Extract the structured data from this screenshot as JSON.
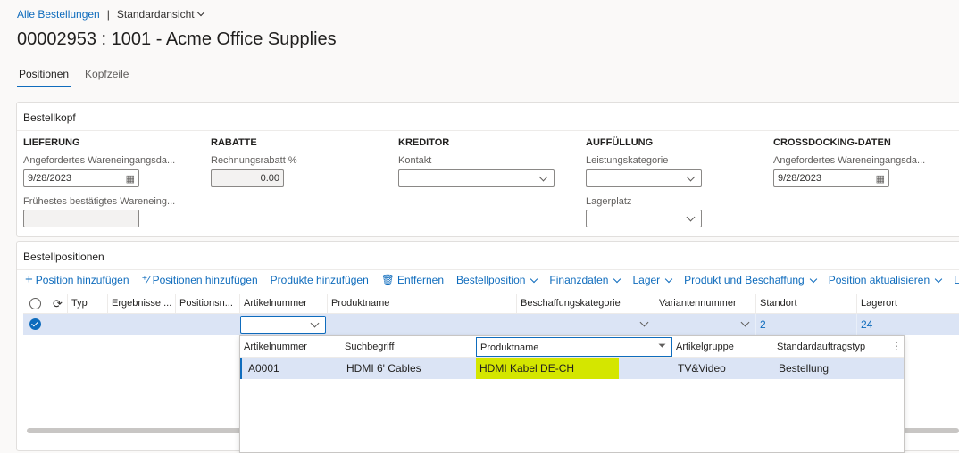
{
  "breadcrumb": {
    "all_orders": "Alle Bestellungen",
    "view": "Standardansicht"
  },
  "page_title": "00002953 : 1001 - Acme Office Supplies",
  "tabs": [
    {
      "label": "Positionen"
    },
    {
      "label": "Kopfzeile"
    }
  ],
  "header_section": {
    "title": "Bestellkopf",
    "groups": {
      "delivery": {
        "title": "LIEFERUNG",
        "requested_label": "Angefordertes Wareneingangsda...",
        "requested_value": "9/28/2023",
        "confirmed_label": "Frühestes bestätigtes Wareneing...",
        "confirmed_value": ""
      },
      "discounts": {
        "title": "RABATTE",
        "invoice_discount_label": "Rechnungsrabatt %",
        "invoice_discount_value": "0.00"
      },
      "vendor": {
        "title": "KREDITOR",
        "contact_label": "Kontakt",
        "contact_value": ""
      },
      "replenishment": {
        "title": "AUFFÜLLUNG",
        "service_category_label": "Leistungskategorie",
        "service_category_value": "",
        "warehouse_location_label": "Lagerplatz",
        "warehouse_location_value": ""
      },
      "crossdocking": {
        "title": "CROSSDOCKING-DATEN",
        "requested_label": "Angefordertes Wareneingangsda...",
        "requested_value": "9/28/2023"
      }
    }
  },
  "lines_section": {
    "title": "Bestellpositionen",
    "toolbar": [
      {
        "icon": "plus-icon",
        "label": "Position hinzufügen"
      },
      {
        "icon": "add-lines-icon",
        "label": "Positionen hinzufügen"
      },
      {
        "icon": "",
        "label": "Produkte hinzufügen"
      },
      {
        "icon": "trash-icon",
        "label": "Entfernen"
      },
      {
        "icon": "",
        "label": "Bestellposition",
        "dropdown": true
      },
      {
        "icon": "",
        "label": "Finanzdaten",
        "dropdown": true
      },
      {
        "icon": "",
        "label": "Lager",
        "dropdown": true
      },
      {
        "icon": "",
        "label": "Produkt und Beschaffung",
        "dropdown": true
      },
      {
        "icon": "",
        "label": "Position aktualisieren",
        "dropdown": true
      },
      {
        "icon": "",
        "label": "La"
      }
    ],
    "columns": [
      "Typ",
      "Ergebnisse ...",
      "Positionsn...",
      "Artikelnummer",
      "Produktname",
      "Beschaffungskategorie",
      "Variantennummer",
      "Standort",
      "Lagerort"
    ],
    "row": {
      "artikelnummer": "",
      "standort": "2",
      "lagerort": "24"
    }
  },
  "lookup": {
    "columns": [
      "Artikelnummer",
      "Suchbegriff",
      "Produktname",
      "Artikelgruppe",
      "Standardauftragstyp"
    ],
    "rows": [
      {
        "artikelnummer": "A0001",
        "suchbegriff": "HDMI 6' Cables",
        "produktname": "HDMI Kabel DE-CH",
        "artikelgruppe": "TV&Video",
        "standardauftragstyp": "Bestellung"
      }
    ]
  },
  "colors": {
    "accent": "#0f6cbd",
    "highlight": "#d4e600",
    "selected_row": "#dbe4f5"
  }
}
